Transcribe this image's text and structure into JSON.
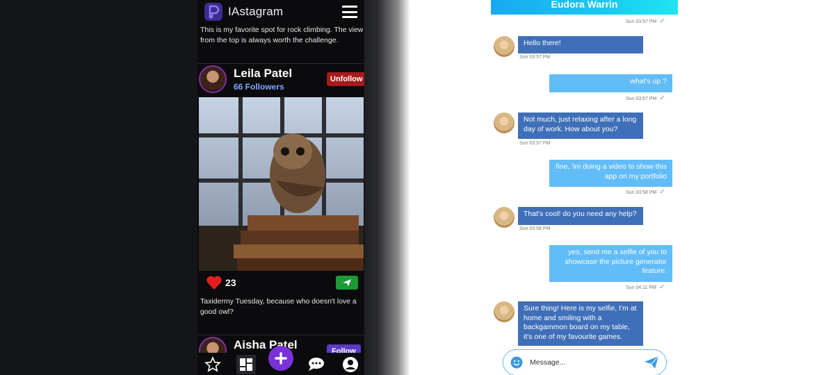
{
  "app": {
    "title": "IAstagram",
    "top_caption": "This is my favorite spot for rock climbing. The view from the top is always worth the challenge."
  },
  "posts": [
    {
      "author": "Leila Patel",
      "followers": "66 Followers",
      "follow_label": "Unfollow",
      "likes": "23",
      "caption": "Taxidermy Tuesday, because who doesn't love a good owl?"
    },
    {
      "author": "Aisha Patel",
      "follow_label": "Follow"
    }
  ],
  "bottom_nav": [
    "star-icon",
    "dashboard-icon",
    "add-icon",
    "chat-icon",
    "profile-icon"
  ],
  "chat": {
    "contact_name": "Eudora Warrin",
    "header_time": "Sun 03:57 PM",
    "messages": [
      {
        "dir": "in",
        "text": "Hello there!",
        "time": "Sun 03:57 PM"
      },
      {
        "dir": "out",
        "text": "what's up ?",
        "time": "Sun 03:57 PM"
      },
      {
        "dir": "in",
        "text": "Not much, just relaxing after a long day of work. How about you?",
        "time": "Sun 03:57 PM"
      },
      {
        "dir": "out",
        "text": "fine, 'im doing a video to show this app on my portfolio",
        "time": "Sun 03:58 PM"
      },
      {
        "dir": "in",
        "text": "That's cool! do you need any help?",
        "time": "Sun 03:58 PM"
      },
      {
        "dir": "out",
        "text": "yes, send me a selfie of you to showcase the picture generator feature.",
        "time": "Sun 04:11 PM"
      },
      {
        "dir": "in",
        "text": "Sure thing! Here is my selfie, I'm at home and smiling with a backgammon board on my table, it's one of my favourite games.",
        "time": ""
      }
    ],
    "input_placeholder": "Message..."
  },
  "colors": {
    "like_heart": "#e02020",
    "unfollow_bg": "#a61b1b",
    "follow_bg": "#5b3bc4",
    "incoming_bubble": "#3f6fb8",
    "outgoing_bubble": "#62bcf7",
    "header_gradient_start": "#18a9f1",
    "add_button": "#7a31d8"
  }
}
